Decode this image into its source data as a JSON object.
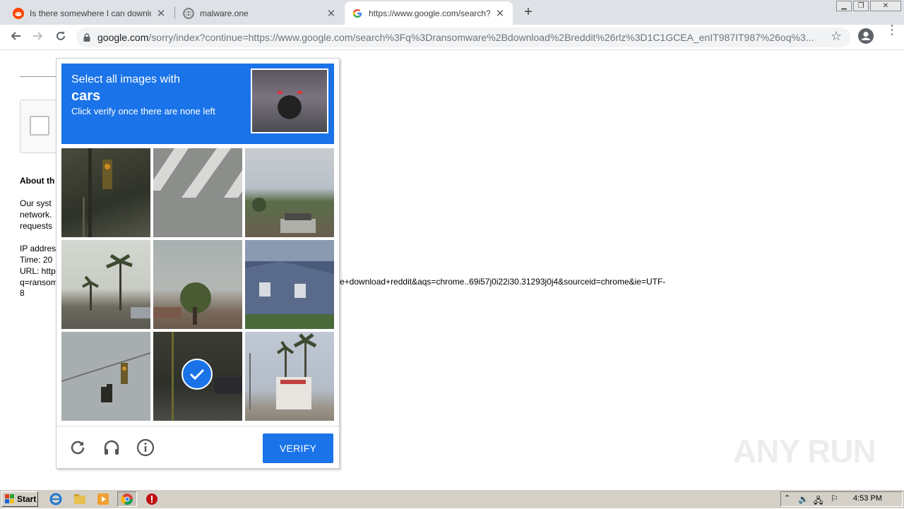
{
  "browser": {
    "tabs": [
      {
        "title": "Is there somewhere I can download",
        "favicon": "reddit-icon",
        "active": false
      },
      {
        "title": "malware.one",
        "favicon": "globe-icon",
        "active": false
      },
      {
        "title": "https://www.google.com/search?q=",
        "favicon": "google-icon",
        "active": true
      }
    ],
    "new_tab_symbol": "+",
    "url_host": "google.com",
    "url_path": "/sorry/index?continue=https://www.google.com/search%3Fq%3Dransomware%2Bdownload%2Breddit%26rlz%3D1C1GCEA_enIT987IT987%26oq%3..."
  },
  "page": {
    "about_heading": "About th",
    "body_lines": [
      "Our syst",
      "network.",
      "requests"
    ],
    "ip_line": "IP addres",
    "time_line": "Time: 20",
    "url_line": "URL: http",
    "q_line": "q=ransom",
    "url_tail": "e+download+reddit&aqs=chrome..69i57j0i22i30.31293j0j4&sourceid=chrome&ie=UTF-",
    "url_tail_end": "8"
  },
  "captcha": {
    "instruction_line1": "Select all images with",
    "target_object": "cars",
    "instruction_line3": "Click verify once there are none left",
    "verify_label": "VERIFY",
    "tiles": [
      {
        "subject": "traffic-light",
        "selected": false
      },
      {
        "subject": "crosswalk",
        "selected": false
      },
      {
        "subject": "hills-houses",
        "selected": false
      },
      {
        "subject": "palm-trees",
        "selected": false
      },
      {
        "subject": "tree-street",
        "selected": false
      },
      {
        "subject": "house",
        "selected": false
      },
      {
        "subject": "traffic-lights",
        "selected": false
      },
      {
        "subject": "street-car",
        "selected": true
      },
      {
        "subject": "palm-trees-building",
        "selected": false
      }
    ]
  },
  "watermark": "ANY RUN",
  "taskbar": {
    "start_label": "Start",
    "clock": "4:53 PM"
  },
  "colors": {
    "accent": "#1a73e8",
    "tabstrip": "#dee1e6",
    "taskbar": "#d4d0c8"
  }
}
